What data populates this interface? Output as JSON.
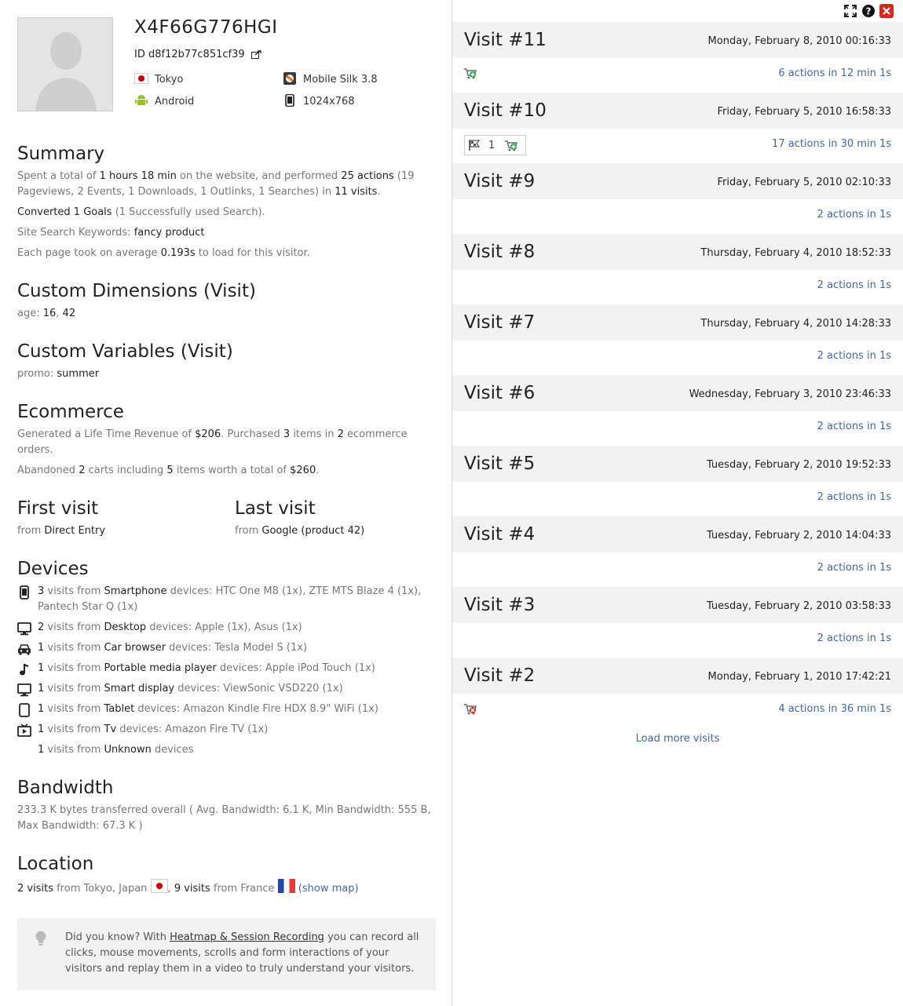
{
  "profile": {
    "visitor_id": "X4F66G776HGI",
    "id_label": "ID d8f12b77c851cf39",
    "attributes": [
      {
        "icon": "japan-flag-icon",
        "label": "Tokyo"
      },
      {
        "icon": "mobile-silk-browser-icon",
        "label": "Mobile Silk 3.8"
      },
      {
        "icon": "android-icon",
        "label": "Android"
      },
      {
        "icon": "tablet-icon",
        "label": "1024x768"
      }
    ]
  },
  "summary": {
    "heading": "Summary",
    "t1": "Spent a total of ",
    "v1": "1 hours 18 min",
    "t2": " on the website, and performed ",
    "v2": "25 actions",
    "t3": " (19 Pageviews, 2 Events, 1 Downloads, 1 Outlinks, 1 Searches) in ",
    "v3": "11 visits",
    "t4": ".",
    "goals_strong": "Converted 1 Goals",
    "goals_rest": " (1 Successfully used Search).",
    "kw_label": "Site Search Keywords: ",
    "kw_value": "fancy product",
    "load_t1": "Each page took on average ",
    "load_v": "0.193s",
    "load_t2": " to load for this visitor."
  },
  "custom_dimensions": {
    "heading": "Custom Dimensions (Visit)",
    "label": "age: ",
    "v1": "16",
    "sep": ", ",
    "v2": "42"
  },
  "custom_variables": {
    "heading": "Custom Variables (Visit)",
    "label": "promo: ",
    "value": "summer"
  },
  "ecommerce": {
    "heading": "Ecommerce",
    "t1": "Generated a Life Time Revenue of ",
    "revenue": "$206",
    "t2": ". Purchased ",
    "items": "3",
    "t3": " items in ",
    "orders": "2",
    "t4": " ecommerce orders.",
    "a1": "Abandoned ",
    "carts": "2",
    "a2": " carts including ",
    "citems": "5",
    "a3": " items worth a total of ",
    "ctotal": "$260",
    "a4": "."
  },
  "first_visit": {
    "heading": "First visit",
    "from": "from ",
    "value": "Direct Entry"
  },
  "last_visit": {
    "heading": "Last visit",
    "from": "from ",
    "value": "Google (product 42)"
  },
  "devices": {
    "heading": "Devices",
    "rows": [
      {
        "icon": "smartphone-icon",
        "count": "3",
        "mid": " visits from ",
        "type": "Smartphone",
        "rest": " devices: HTC One M8 (1x), ZTE MTS Blaze 4 (1x), Pantech Star Q (1x)"
      },
      {
        "icon": "desktop-icon",
        "count": "2",
        "mid": " visits from ",
        "type": "Desktop",
        "rest": " devices: Apple (1x), Asus (1x)"
      },
      {
        "icon": "car-icon",
        "count": "1",
        "mid": " visits from ",
        "type": "Car browser",
        "rest": " devices: Tesla Model S (1x)"
      },
      {
        "icon": "music-note-icon",
        "count": "1",
        "mid": " visits from ",
        "type": "Portable media player",
        "rest": " devices: Apple iPod Touch (1x)"
      },
      {
        "icon": "smart-display-icon",
        "count": "1",
        "mid": " visits from ",
        "type": "Smart display",
        "rest": " devices: ViewSonic VSD220 (1x)"
      },
      {
        "icon": "tablet-icon",
        "count": "1",
        "mid": " visits from ",
        "type": "Tablet",
        "rest": " devices: Amazon Kindle Fire HDX 8.9\" WiFi (1x)"
      },
      {
        "icon": "tv-icon",
        "count": "1",
        "mid": " visits from ",
        "type": "Tv",
        "rest": " devices: Amazon Fire TV (1x)"
      },
      {
        "icon": "",
        "count": "1",
        "mid": " visits from ",
        "type": "Unknown",
        "rest": " devices"
      }
    ]
  },
  "bandwidth": {
    "heading": "Bandwidth",
    "text": "233.3 K bytes transferred overall ( Avg. Bandwidth: 6.1 K, Min Bandwidth: 555 B, Max Bandwidth: 67.3 K )"
  },
  "location": {
    "heading": "Location",
    "v1": "2 visits",
    "t1": " from Tokyo, Japan ",
    "sep": ", ",
    "v2": "9 visits",
    "t2": " from France ",
    "map_link": "(show map)"
  },
  "tip": {
    "t1": "Did you know? With ",
    "link": "Heatmap & Session Recording",
    "t2": " you can record all clicks, mouse movements, scrolls and form interactions of your visitors and replay them in a video to truly understand your visitors."
  },
  "visits": [
    {
      "title": "Visit #11",
      "date": "Monday, February 8, 2010 00:16:33",
      "actions": "6 actions in 12 min 1s",
      "icon": "cart-add"
    },
    {
      "title": "Visit #10",
      "date": "Friday, February 5, 2010 16:58:33",
      "actions": "17 actions in 30 min 1s",
      "icon": "goal",
      "goal_count": "1"
    },
    {
      "title": "Visit #9",
      "date": "Friday, February 5, 2010 02:10:33",
      "actions": "2 actions in 1s"
    },
    {
      "title": "Visit #8",
      "date": "Thursday, February 4, 2010 18:52:33",
      "actions": "2 actions in 1s"
    },
    {
      "title": "Visit #7",
      "date": "Thursday, February 4, 2010 14:28:33",
      "actions": "2 actions in 1s"
    },
    {
      "title": "Visit #6",
      "date": "Wednesday, February 3, 2010 23:46:33",
      "actions": "2 actions in 1s"
    },
    {
      "title": "Visit #5",
      "date": "Tuesday, February 2, 2010 19:52:33",
      "actions": "2 actions in 1s"
    },
    {
      "title": "Visit #4",
      "date": "Tuesday, February 2, 2010 14:04:33",
      "actions": "2 actions in 1s"
    },
    {
      "title": "Visit #3",
      "date": "Tuesday, February 2, 2010 03:58:33",
      "actions": "2 actions in 1s"
    },
    {
      "title": "Visit #2",
      "date": "Monday, February 1, 2010 17:42:21",
      "actions": "4 actions in 36 min 1s",
      "icon": "cart-abandoned"
    }
  ],
  "load_more": "Load more visits",
  "colors": {
    "link": "#4068a8",
    "header_bg": "#f2f2f2",
    "close": "#d4291f"
  }
}
